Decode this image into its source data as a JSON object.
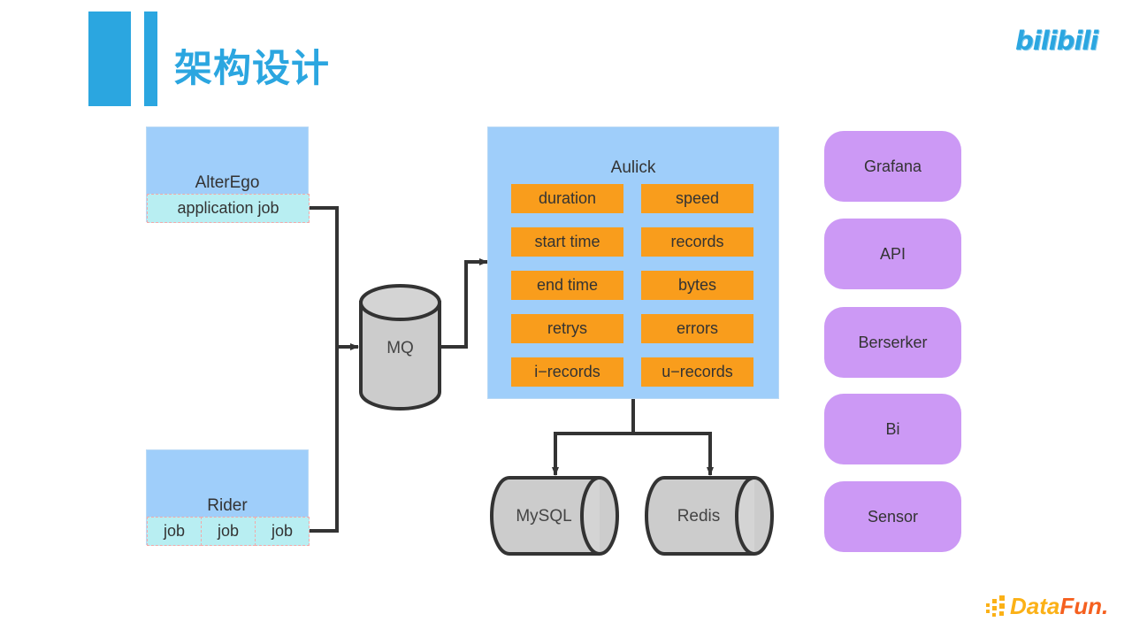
{
  "header": {
    "title": "架构设计",
    "accent_color": "#2BA6E0",
    "brand_logo": "bilibili",
    "bar_wide": "title-accent-bar-wide",
    "bar_narrow": "title-accent-bar-narrow"
  },
  "footer": {
    "logo_data": "Data",
    "logo_fun": "Fun.",
    "logo_dots": "datafun-dots",
    "data_color": "#FBB117",
    "fun_color": "#F5601F"
  },
  "diagram": {
    "type": "architecture-flow",
    "colors": {
      "panel_blue": "#9FCEFA",
      "chip_cyan": "#B8EEF2",
      "chip_cyan_border": "#F2A9A9",
      "metric_orange": "#F99D1C",
      "pill_purple": "#CC99F5",
      "cylinder_gray": "#CCCCCC",
      "stroke_dark": "#333333"
    },
    "producers": [
      {
        "id": "alterego",
        "title": "AlterEgo",
        "chips": [
          "application job"
        ]
      },
      {
        "id": "rider",
        "title": "Rider",
        "chips": [
          "job",
          "job",
          "job"
        ]
      }
    ],
    "queue": {
      "id": "mq",
      "label": "MQ",
      "shape": "cylinder-vertical"
    },
    "processor": {
      "id": "aulick",
      "title": "Aulick",
      "metrics_left": [
        "duration",
        "start time",
        "end time",
        "retrys",
        "i−records"
      ],
      "metrics_right": [
        "speed",
        "records",
        "bytes",
        "errors",
        "u−records"
      ]
    },
    "stores": [
      {
        "id": "mysql",
        "label": "MySQL",
        "shape": "cylinder-horizontal"
      },
      {
        "id": "redis",
        "label": "Redis",
        "shape": "cylinder-horizontal"
      }
    ],
    "consumers": [
      {
        "id": "grafana",
        "label": "Grafana"
      },
      {
        "id": "api",
        "label": "API"
      },
      {
        "id": "berserker",
        "label": "Berserker"
      },
      {
        "id": "bi",
        "label": "Bi"
      },
      {
        "id": "sensor",
        "label": "Sensor"
      }
    ]
  }
}
